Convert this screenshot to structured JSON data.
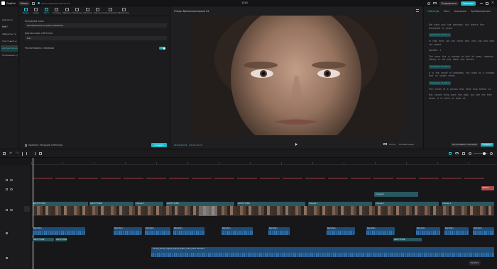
{
  "app": {
    "name": "CapCut",
    "menu_label": "Меню",
    "autosave_label": "Автосохранение 00:17:18",
    "title": "1010",
    "share_label": "Поделиться",
    "export_label": "Экспорт"
  },
  "toolbar": {
    "tabs": [
      "Медиа",
      "Аудио",
      "Текст",
      "Стикеры",
      "Эффекты",
      "Переходы",
      "Субтитры",
      "Фильтры",
      "Корректировка",
      "ИИ-аватары"
    ],
    "active_index": 0
  },
  "leftnav": {
    "items": [
      "Добавить текст",
      "Мои",
      "Эффекты те",
      "Текстовый ш",
      "Автоматическ",
      "Локальные су"
    ]
  },
  "settings": {
    "source_language_label": "Исходный язык",
    "source_language_value": "Автоматическое распознавание",
    "bilingual_label": "Двуязычные субтитры",
    "bilingual_value": "Нет",
    "identify_speakers_label": "Распознавать спикеров",
    "clear_subtitles_label": "Удалить текущие субтитры",
    "create_button": "Создать"
  },
  "player": {
    "title": "Плеер: Временная шкала 01",
    "time_current": "00:00:40:19",
    "time_total": "00:05:43:20",
    "ratio_label": "Соотн.",
    "fullscreen_label": "Полный экран"
  },
  "rightpanel": {
    "tabs": [
      "Субтитры",
      "Текст",
      "Анимация",
      "Преобразование"
    ],
    "active_index": 0,
    "entries": [
      {
        "type": "text",
        "text": "We have only the precisely, but there's five thousands of years."
      },
      {
        "type": "speaker",
        "text": "Спикер 2 (1,55 с)"
      },
      {
        "type": "text",
        "text": "In that time, we can move very very slip and then not object."
      },
      {
        "type": "text",
        "text": "Speaker 1"
      },
      {
        "type": "text",
        "text": "The more this is enough to find its away, however history is not just ideas and stories."
      },
      {
        "type": "speaker",
        "text": "Спикер 1 (1,16 с)"
      },
      {
        "type": "text",
        "text": "It is the sound of footsteps, the night to a window that no longer exists."
      },
      {
        "type": "speaker",
        "text": "Спикер 1 (1,38 с)"
      },
      {
        "type": "text",
        "text": "The hands of a person who lived long before us."
      },
      {
        "type": "text",
        "text": "Not carved thing back the past, but see me then whom it to think of walls at."
      }
    ],
    "speaker_button": "Распознавать спикеров",
    "create_button": "Создать"
  },
  "timeline": {
    "clip_label": "ШАТСТ7АВЯ",
    "speaker_clip_label": "Спикер 1",
    "audio_label": "Narration",
    "main_audio_label": "extract_audio_original_capcut_editor_main_track 03:18:43",
    "sticker_label": "ШАТСТ",
    "ai_label": "Бумера"
  },
  "colors": {
    "accent": "#1fb6c7",
    "audio": "#1d4c78",
    "text_track": "#2a5860"
  },
  "icons": [
    "menu-icon",
    "play-icon",
    "undo-icon",
    "redo-icon",
    "split-icon",
    "delete-icon",
    "zoom-icon",
    "magnet-icon"
  ]
}
